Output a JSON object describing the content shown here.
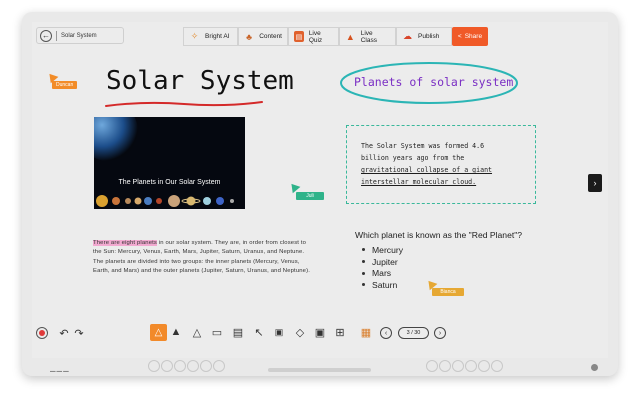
{
  "header": {
    "breadcrumb_title": "Solar System",
    "tools": [
      "Bright AI",
      "Content",
      "Live Quiz",
      "Live Class",
      "Publish"
    ],
    "share_label": "Share"
  },
  "canvas": {
    "main_heading": "Solar System",
    "circled_title": "Planets of solar system",
    "banner_title": "The Planets in Our Solar System",
    "note_lines": [
      "The Solar System was formed 4.6",
      "billion years ago from the",
      "gravitational collapse of a giant",
      "interstellar molecular cloud."
    ],
    "paragraph_hl": "There are eight planets",
    "paragraph_rest": " in our solar system. They are, in order from closest to the Sun: Mercury, Venus, Earth, Mars, Jupiter, Saturn, Uranus, and Neptune. The planets are divided into two groups: the inner planets (Mercury, Venus, Earth, and Mars) and the outer planets (Jupiter, Saturn, Uranus, and Neptune).",
    "quiz_question": "Which planet is known as the \"Red Planet\"?",
    "quiz_options": [
      "Mercury",
      "Jupiter",
      "Mars",
      "Saturn"
    ]
  },
  "cursors": [
    {
      "name": "Duncan",
      "color": "#f28c28"
    },
    {
      "name": "Juli",
      "color": "#2fb38a"
    },
    {
      "name": "Bianca",
      "color": "#e6a833"
    }
  ],
  "pager": {
    "label": "3 / 30"
  },
  "colors": {
    "accent": "#f05a28",
    "note_border": "#3ab89b",
    "title_purple": "#7b2fc4",
    "underline_red": "#d42a2a",
    "circle_teal": "#2bb5b5"
  }
}
